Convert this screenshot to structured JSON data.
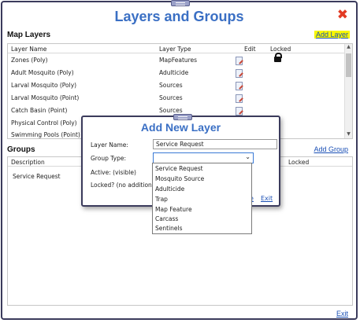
{
  "window": {
    "title": "Layers and Groups",
    "close_icon": "close-x-icon",
    "close_color": "#e23b24",
    "title_color": "#3a6fc4"
  },
  "map_layers": {
    "section_title": "Map Layers",
    "add_link": "Add Layer",
    "columns": {
      "name": "Layer Name",
      "type": "Layer Type",
      "edit": "Edit",
      "locked": "Locked"
    },
    "rows": [
      {
        "name": "Zones (Poly)",
        "type": "MapFeatures",
        "locked": true
      },
      {
        "name": "Adult Mosquito (Poly)",
        "type": "Adulticide",
        "locked": false
      },
      {
        "name": "Larval Mosquito (Poly)",
        "type": "Sources",
        "locked": false
      },
      {
        "name": "Larval Mosquito (Point)",
        "type": "Sources",
        "locked": false
      },
      {
        "name": "Catch Basin (Point)",
        "type": "Sources",
        "locked": false
      },
      {
        "name": "Physical Control (Poly)",
        "type": "Sources",
        "locked": false
      },
      {
        "name": "Swimming Pools (Point)",
        "type": "",
        "locked": false
      }
    ]
  },
  "groups": {
    "section_title": "Groups",
    "add_link": "Add Group",
    "columns": {
      "description": "Description",
      "locked": "Locked"
    },
    "rows": [
      {
        "description": "Service Request"
      }
    ],
    "exit_link": "Exit"
  },
  "dialog": {
    "title": "Add New Layer",
    "layer_name_label": "Layer Name:",
    "layer_name_value": "Service Request",
    "group_type_label": "Group Type:",
    "group_type_value": "",
    "active_label": "Active: (visible)",
    "locked_label": "Locked? (no additions)",
    "save_partial": "e",
    "exit_link": "Exit",
    "options": [
      "Service Request",
      "Mosquito Source",
      "Adulticide",
      "Trap",
      "Map Feature",
      "Carcass",
      "Sentinels"
    ]
  },
  "highlight_color": "#f7f700"
}
